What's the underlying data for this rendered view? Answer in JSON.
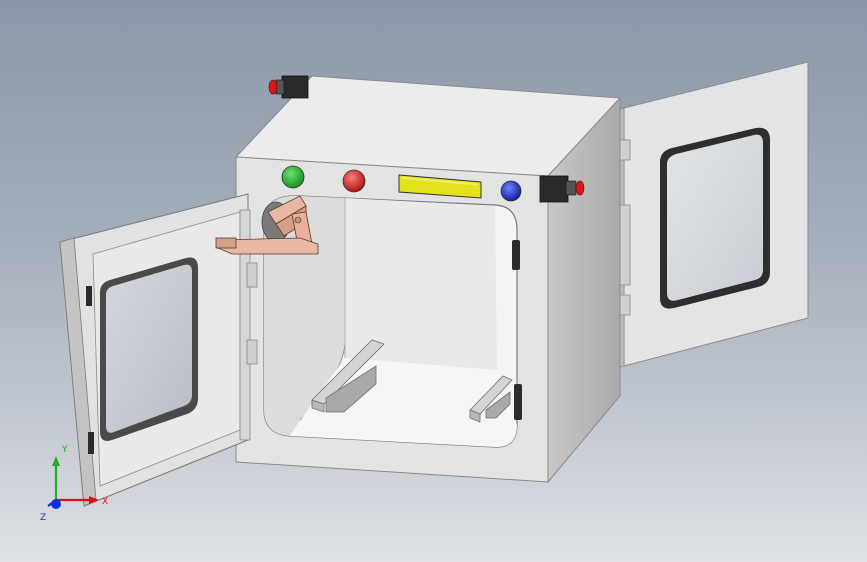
{
  "scene": {
    "description_hidden": "",
    "colors": {
      "background_top": "#8b98a9",
      "background_bottom": "#dfe1e4",
      "cabinet_front": "#e3e3e3",
      "cabinet_side": "#bfbfbf",
      "cabinet_top": "#ececec",
      "interior_floor": "#f1f1f1",
      "door_panel": "#e6e6e6",
      "window_glass": "#c5c9cf",
      "gasket": "#3a3a3a",
      "indicator_green": "#1fae2a",
      "indicator_red": "#d51f1f",
      "indicator_blue": "#1428c8",
      "display_yellow": "#e3e21c",
      "clamp_copper": "#e9b8a2",
      "rail_grey": "#c7c7c7"
    },
    "indicators": [
      {
        "name": "green-indicator-light",
        "color": "#1fae2a"
      },
      {
        "name": "red-indicator-light",
        "color": "#d51f1f"
      },
      {
        "name": "blue-indicator-light",
        "color": "#1428c8"
      }
    ]
  },
  "triad": {
    "x_label": "X",
    "y_label": "Y",
    "z_label": "Z",
    "x_color": "#e01010",
    "y_color": "#22b020",
    "z_color": "#1030e0"
  }
}
